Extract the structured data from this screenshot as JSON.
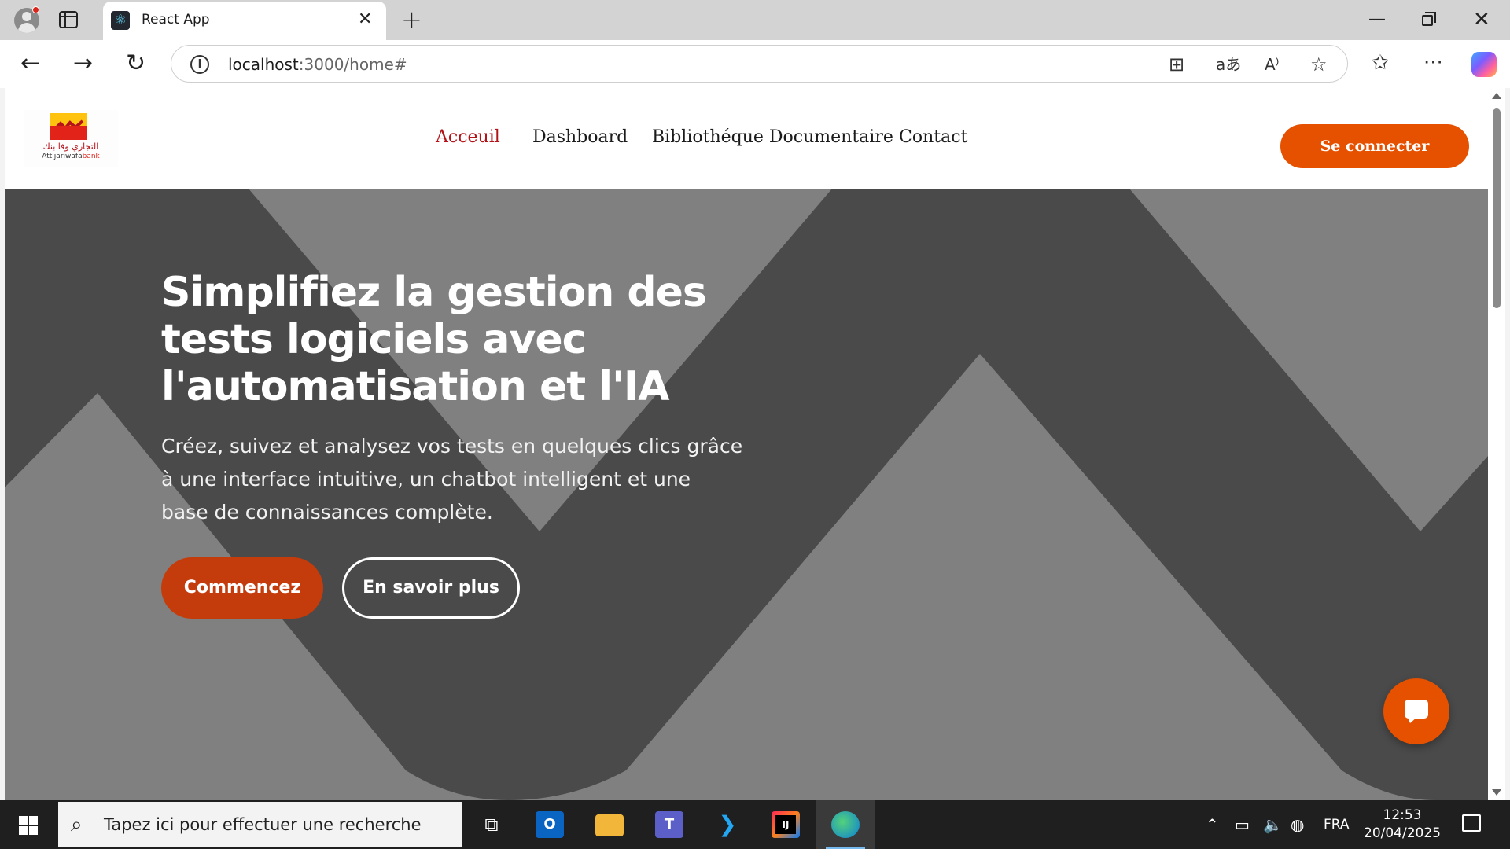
{
  "browser": {
    "tab_title": "React App",
    "url_host": "localhost",
    "url_rest": ":3000/home#",
    "new_tab": "+",
    "close": "✕"
  },
  "site": {
    "logo": {
      "arabic": "التجاري وفا بنك",
      "name": "Attijariwafa",
      "bank": "bank"
    },
    "nav": [
      {
        "label": "Acceuil",
        "active": true
      },
      {
        "label": "Dashboard",
        "active": false
      },
      {
        "label": "Bibliothéque Documentaire",
        "active": false
      },
      {
        "label": "Contact",
        "active": false
      }
    ],
    "login_button": "Se connecter",
    "accent_color": "#e65100",
    "active_nav_color": "#b31217"
  },
  "hero": {
    "title": "Simplifiez la gestion des tests logiciels avec l'automatisation et l'IA",
    "subtitle": "Créez, suivez et analysez vos tests en quelques clics grâce à une interface intuitive, un chatbot intelligent et une base de connaissances complète.",
    "primary_button": "Commencez",
    "secondary_button": "En savoir plus"
  },
  "taskbar": {
    "search_placeholder": "Tapez ici pour effectuer une recherche",
    "language": "FRA",
    "time": "12:53",
    "date": "20/04/2025",
    "apps": [
      "task-view",
      "outlook",
      "file-explorer",
      "teams",
      "vscode",
      "intellij",
      "edge"
    ]
  }
}
